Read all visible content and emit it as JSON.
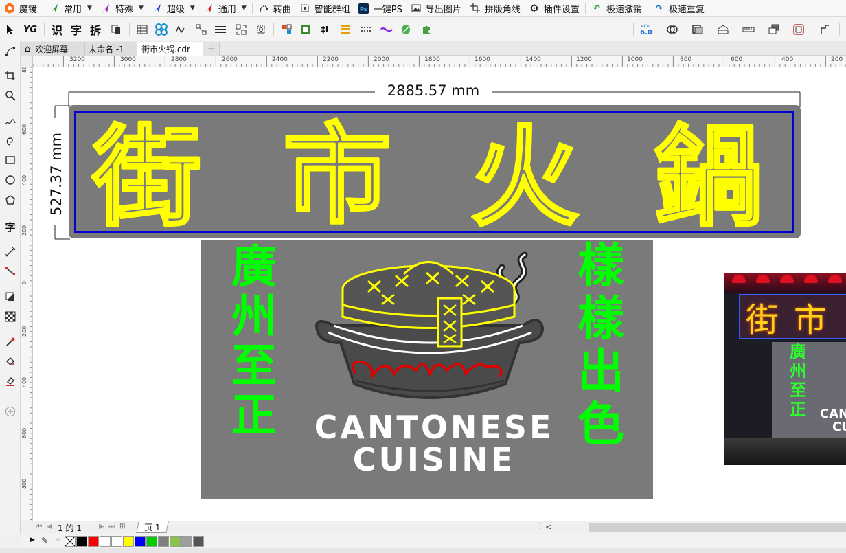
{
  "menubar": {
    "app_name": "魔镜",
    "items": [
      {
        "label": "常用",
        "icon": "green-arrow-icon",
        "color": "#1a9b3c",
        "has_caret": true
      },
      {
        "label": "特殊",
        "icon": "purple-arrow-icon",
        "color": "#9b2bb5",
        "has_caret": true
      },
      {
        "label": "超级",
        "icon": "blue-arrow-icon",
        "color": "#2448c7",
        "has_caret": true
      },
      {
        "label": "通用",
        "icon": "red-arrow-icon",
        "color": "#d01c1c",
        "has_caret": true
      },
      {
        "label": "转曲",
        "icon": "curve-icon",
        "has_caret": false
      },
      {
        "label": "智能群组",
        "icon": "group-icon",
        "has_caret": false
      },
      {
        "label": "一键PS",
        "icon": "ps-icon",
        "has_caret": false
      },
      {
        "label": "导出图片",
        "icon": "image-icon",
        "has_caret": false
      },
      {
        "label": "拼版角线",
        "icon": "cropmark-icon",
        "has_caret": false
      },
      {
        "label": "插件设置",
        "icon": "gear-icon",
        "has_caret": false
      },
      {
        "label": "极速撤销",
        "icon": "undo-icon",
        "has_caret": false
      },
      {
        "label": "极速重复",
        "icon": "redo-icon",
        "has_caret": false
      }
    ]
  },
  "toolbar": {
    "text_tools": [
      "识",
      "字",
      "拆"
    ],
    "ecut_badge": "6.0",
    "ecut_small": "eCut"
  },
  "doctabs": {
    "tabs": [
      {
        "label": "欢迎屏幕",
        "active": false
      },
      {
        "label": "未命名 -1",
        "active": false
      },
      {
        "label": "街市火锅.cdr",
        "active": true
      }
    ],
    "add_label": "+"
  },
  "hruler": {
    "ticks": [
      "3200",
      "3000",
      "2800",
      "2600",
      "2400",
      "2200",
      "2000",
      "1800",
      "1600",
      "1400",
      "1200",
      "1000",
      "800",
      "600",
      "400",
      "200"
    ]
  },
  "vruler": {
    "ticks": [
      "800",
      "600",
      "400",
      "200",
      "0",
      "200",
      "400",
      "600",
      "800"
    ]
  },
  "design": {
    "width_dimension": "2885.57 mm",
    "height_dimension": "527.37 mm",
    "headline_chars": [
      "街",
      "市",
      "火",
      "鍋"
    ],
    "left_column_chars": [
      "廣",
      "州",
      "至",
      "正"
    ],
    "right_column_chars": [
      "樣",
      "樣",
      "出",
      "色"
    ],
    "brand_line1": "CANTONESE",
    "brand_line2": "CUISINE",
    "headline_color": "#ffff00",
    "frame_color": "#0000cc",
    "panel_color": "#7a7a7a",
    "green_text_color": "#00ff00"
  },
  "preview_photo": {
    "chars": [
      "街",
      "市"
    ],
    "side_chars": [
      "廣",
      "州",
      "至",
      "正"
    ],
    "partial_text_1": "CAN",
    "partial_text_2": "CU"
  },
  "pagebar": {
    "page_counter": "1 的 1",
    "page_tab": "页 1"
  },
  "palette": {
    "colors": [
      "#000000",
      "#ff0000",
      "#ffffff",
      "#ffffff",
      "#ffff00",
      "#0000ff",
      "#00cc00",
      "#7f7f7f",
      "#8bc34a",
      "#9e9e9e",
      "#555555"
    ]
  }
}
